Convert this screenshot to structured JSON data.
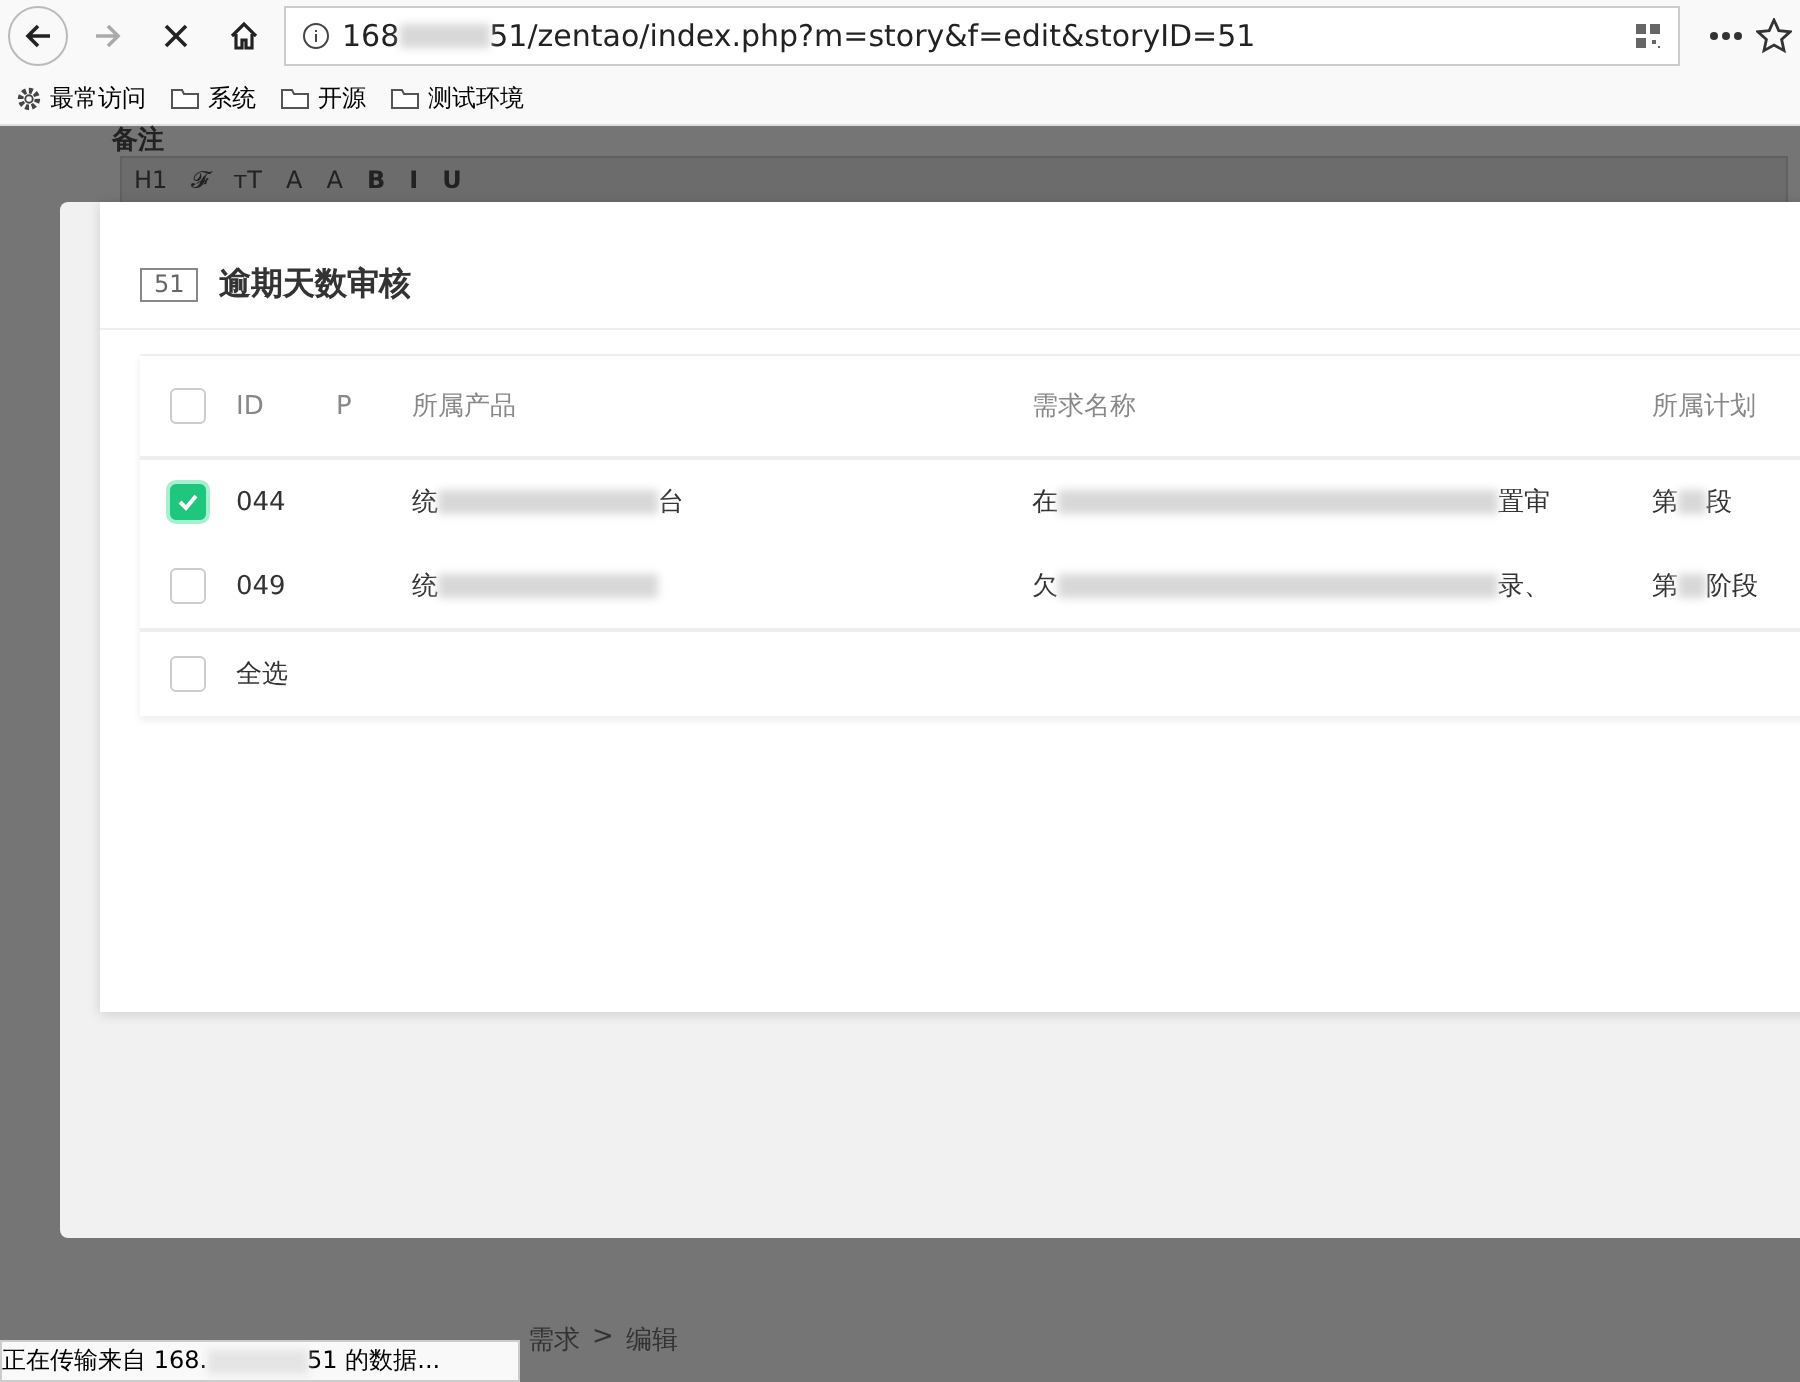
{
  "browser": {
    "url_start": "168",
    "url_end": "51/zentao/index.php?m=story&f=edit&storyID=51",
    "bookmarks": [
      {
        "kind": "gear",
        "label": "最常访问"
      },
      {
        "kind": "folder",
        "label": "系统"
      },
      {
        "kind": "folder",
        "label": "开源"
      },
      {
        "kind": "folder",
        "label": "测试环境"
      }
    ]
  },
  "background": {
    "field_label": "备注",
    "toolbar": [
      "H1",
      "𝓕",
      "тT",
      "A",
      "A",
      "B",
      "I",
      "U"
    ],
    "breadcrumb": [
      "需求",
      ">",
      "编辑"
    ]
  },
  "modal": {
    "id": "51",
    "title": "逾期天数审核",
    "table": {
      "columns": [
        "ID",
        "P",
        "所属产品",
        "需求名称",
        "所属计划"
      ],
      "header_checked": false,
      "rows": [
        {
          "checked": true,
          "id": "044",
          "product": "统",
          "product_end": "台",
          "name": "在",
          "name_end": "置审",
          "plan": "第",
          "plan_end": "段"
        },
        {
          "checked": false,
          "id": "049",
          "product": "统",
          "product_end": "",
          "name": "欠",
          "name_end": "录、",
          "plan": "第",
          "plan_end": "阶段"
        }
      ],
      "select_all": {
        "label": "全选",
        "checked": false
      }
    }
  },
  "status": {
    "start": "正在传输来自 168.",
    "end": "51 的数据..."
  }
}
